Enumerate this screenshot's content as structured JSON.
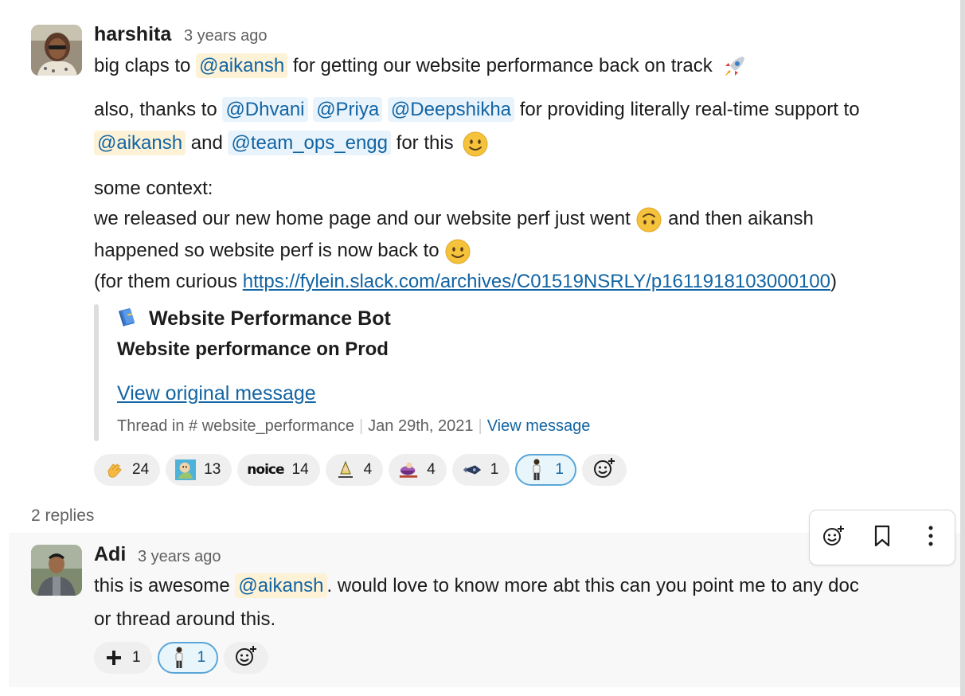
{
  "colors": {
    "link": "#1264a3",
    "mention_bg": "#fdf2d6",
    "mention_blue_bg": "#e8f3fb",
    "reaction_selected_border": "#5aa6d8"
  },
  "message": {
    "author": "harshita",
    "time": "3 years ago",
    "line1": {
      "pre": "big claps to ",
      "mention": "@aikansh",
      "post": " for getting our website performance back on track"
    },
    "line2": {
      "pre": "also, thanks to ",
      "m1": "@Dhvani",
      "m2": "@Priya",
      "m3": "@Deepshikha",
      "post": " for providing literally real-time support to"
    },
    "line3": {
      "m1": "@aikansh",
      "mid": " and ",
      "m2": "@team_ops_engg",
      "post": " for this"
    },
    "line4": "some context:",
    "line5": {
      "pre": "we released our new home page and our website perf just went ",
      "post": " and then aikansh"
    },
    "line6": "happened so website perf is now back to",
    "line7": {
      "pre": "(for them curious ",
      "link": "https://fylein.slack.com/archives/C01519NSRLY/p1611918103000100",
      "post": ")"
    },
    "attachment": {
      "bot_name": "Website Performance Bot",
      "subtitle": "Website performance on Prod",
      "view_original": "View original message",
      "meta_thread": "Thread in # website_performance",
      "meta_date": "Jan 29th, 2021",
      "meta_view": "View message"
    },
    "reactions": [
      {
        "icon": "clap-icon",
        "count": "24"
      },
      {
        "icon": "custom-face-icon",
        "count": "13"
      },
      {
        "icon": "noice-icon",
        "count": "14",
        "text": "noice"
      },
      {
        "icon": "bell-hands-icon",
        "count": "4"
      },
      {
        "icon": "pot-icon",
        "count": "4"
      },
      {
        "icon": "rocket-small-icon",
        "count": "1"
      },
      {
        "icon": "person-standing-icon",
        "count": "1",
        "selected": true
      }
    ]
  },
  "replies_label": "2 replies",
  "reply": {
    "author": "Adi",
    "time": "3 years ago",
    "line1": {
      "pre": "this is awesome ",
      "mention": "@aikansh",
      "post": ". would love to know more abt this can you point me to any doc"
    },
    "line2": "or thread around this.",
    "reactions": [
      {
        "icon": "plus-icon",
        "count": "1"
      },
      {
        "icon": "person-standing-icon",
        "count": "1",
        "selected": true
      }
    ]
  }
}
